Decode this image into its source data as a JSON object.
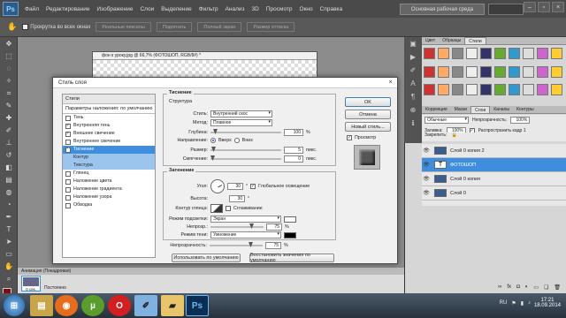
{
  "menubar": {
    "logo": "Ps",
    "items": [
      "Файл",
      "Редактирование",
      "Изображение",
      "Слои",
      "Выделение",
      "Фильтр",
      "Анализ",
      "3D",
      "Просмотр",
      "Окно",
      "Справка"
    ],
    "workspace": "Основная рабочая среда"
  },
  "options": {
    "scroll_all": "Прокрутка во всех окнах",
    "buttons": [
      "Реальные пикселы",
      "Подогнать",
      "Полный экран",
      "Размер оттиска"
    ]
  },
  "document": {
    "title": "фон к уроку.jpg @ 66,7% (ФОТОШОП, RGB/8#) *"
  },
  "dialog": {
    "title": "Стиль слоя",
    "list_header": "Стили",
    "blend_options": "Параметры наложения: по умолчанию",
    "items": [
      {
        "label": "Тень",
        "checked": false
      },
      {
        "label": "Внутренняя тень",
        "checked": true
      },
      {
        "label": "Внешнее свечение",
        "checked": true
      },
      {
        "label": "Внутреннее свечение",
        "checked": false
      },
      {
        "label": "Тиснение",
        "checked": true,
        "selected": true
      },
      {
        "label": "Контур",
        "checked": false,
        "sub": true
      },
      {
        "label": "Текстура",
        "checked": false,
        "sub": true
      },
      {
        "label": "Глянец",
        "checked": false
      },
      {
        "label": "Наложение цвета",
        "checked": false
      },
      {
        "label": "Наложение градиента",
        "checked": false
      },
      {
        "label": "Наложение узора",
        "checked": false
      },
      {
        "label": "Обводка",
        "checked": false
      }
    ],
    "bevel": {
      "section": "Тиснение",
      "structure": "Структура",
      "style_label": "Стиль:",
      "style_value": "Внутренний скос",
      "method_label": "Метод:",
      "method_value": "Плавное",
      "depth_label": "Глубина:",
      "depth_value": "100",
      "pct": "%",
      "direction_label": "Направление:",
      "dir_up": "Вверх",
      "dir_down": "Вниз",
      "size_label": "Размер:",
      "size_value": "5",
      "px": "пикс.",
      "soften_label": "Смягчение:",
      "soften_value": "0"
    },
    "shading": {
      "section": "Затенение",
      "angle_label": "Угол:",
      "angle_value": "30",
      "deg": "°",
      "global_light": "Глобальное освещение",
      "altitude_label": "Высота:",
      "altitude_value": "30",
      "gloss_label": "Контур глянца:",
      "antialias": "Сглаживание",
      "highlight_mode_label": "Режим подсветки:",
      "highlight_mode": "Экран",
      "highlight_opacity_label": "Непрозр.:",
      "highlight_opacity": "75",
      "shadow_mode_label": "Режим тени:",
      "shadow_mode": "Умножение",
      "shadow_opacity_label": "Непрозрачность:",
      "shadow_opacity": "75",
      "highlight_color": "#ffffff",
      "shadow_color": "#000000"
    },
    "btn_default": "Использовать по умолчанию",
    "btn_restore": "Восстановить значения по умолчанию",
    "ok": "OK",
    "cancel": "Отмена",
    "new_style": "Новый стиль...",
    "preview": "Просмотр"
  },
  "right": {
    "tabs1": [
      "Цвет",
      "Образцы",
      "Стили"
    ],
    "tabs2": [
      "Коррекция",
      "Маски",
      "Слои",
      "Каналы",
      "Контуры"
    ],
    "blend": "Обычные",
    "opacity_label": "Непрозрачность:",
    "opacity": "100%",
    "lock_label": "Закрепить:",
    "fill_label": "Заливка:",
    "fill": "100%",
    "spread": "Распространить кадр 1",
    "layers": [
      {
        "name": "Слой 0 копия 2",
        "type": "img",
        "sel": false
      },
      {
        "name": "ФОТОШОП",
        "type": "text",
        "sel": true
      },
      {
        "name": "Слой 0 копия",
        "type": "img",
        "sel": false
      },
      {
        "name": "Слой 0",
        "type": "img",
        "sel": false
      }
    ]
  },
  "anim": {
    "title": "Анимация (Покадровая)",
    "frame_time": "0 сек.",
    "loop": "Постоянно"
  },
  "taskbar": {
    "time": "17:21",
    "date": "18.09.2014",
    "lang": "RU"
  },
  "colors": {
    "accent": "#3f8ede",
    "ps_blue": "#2b5c8a"
  }
}
